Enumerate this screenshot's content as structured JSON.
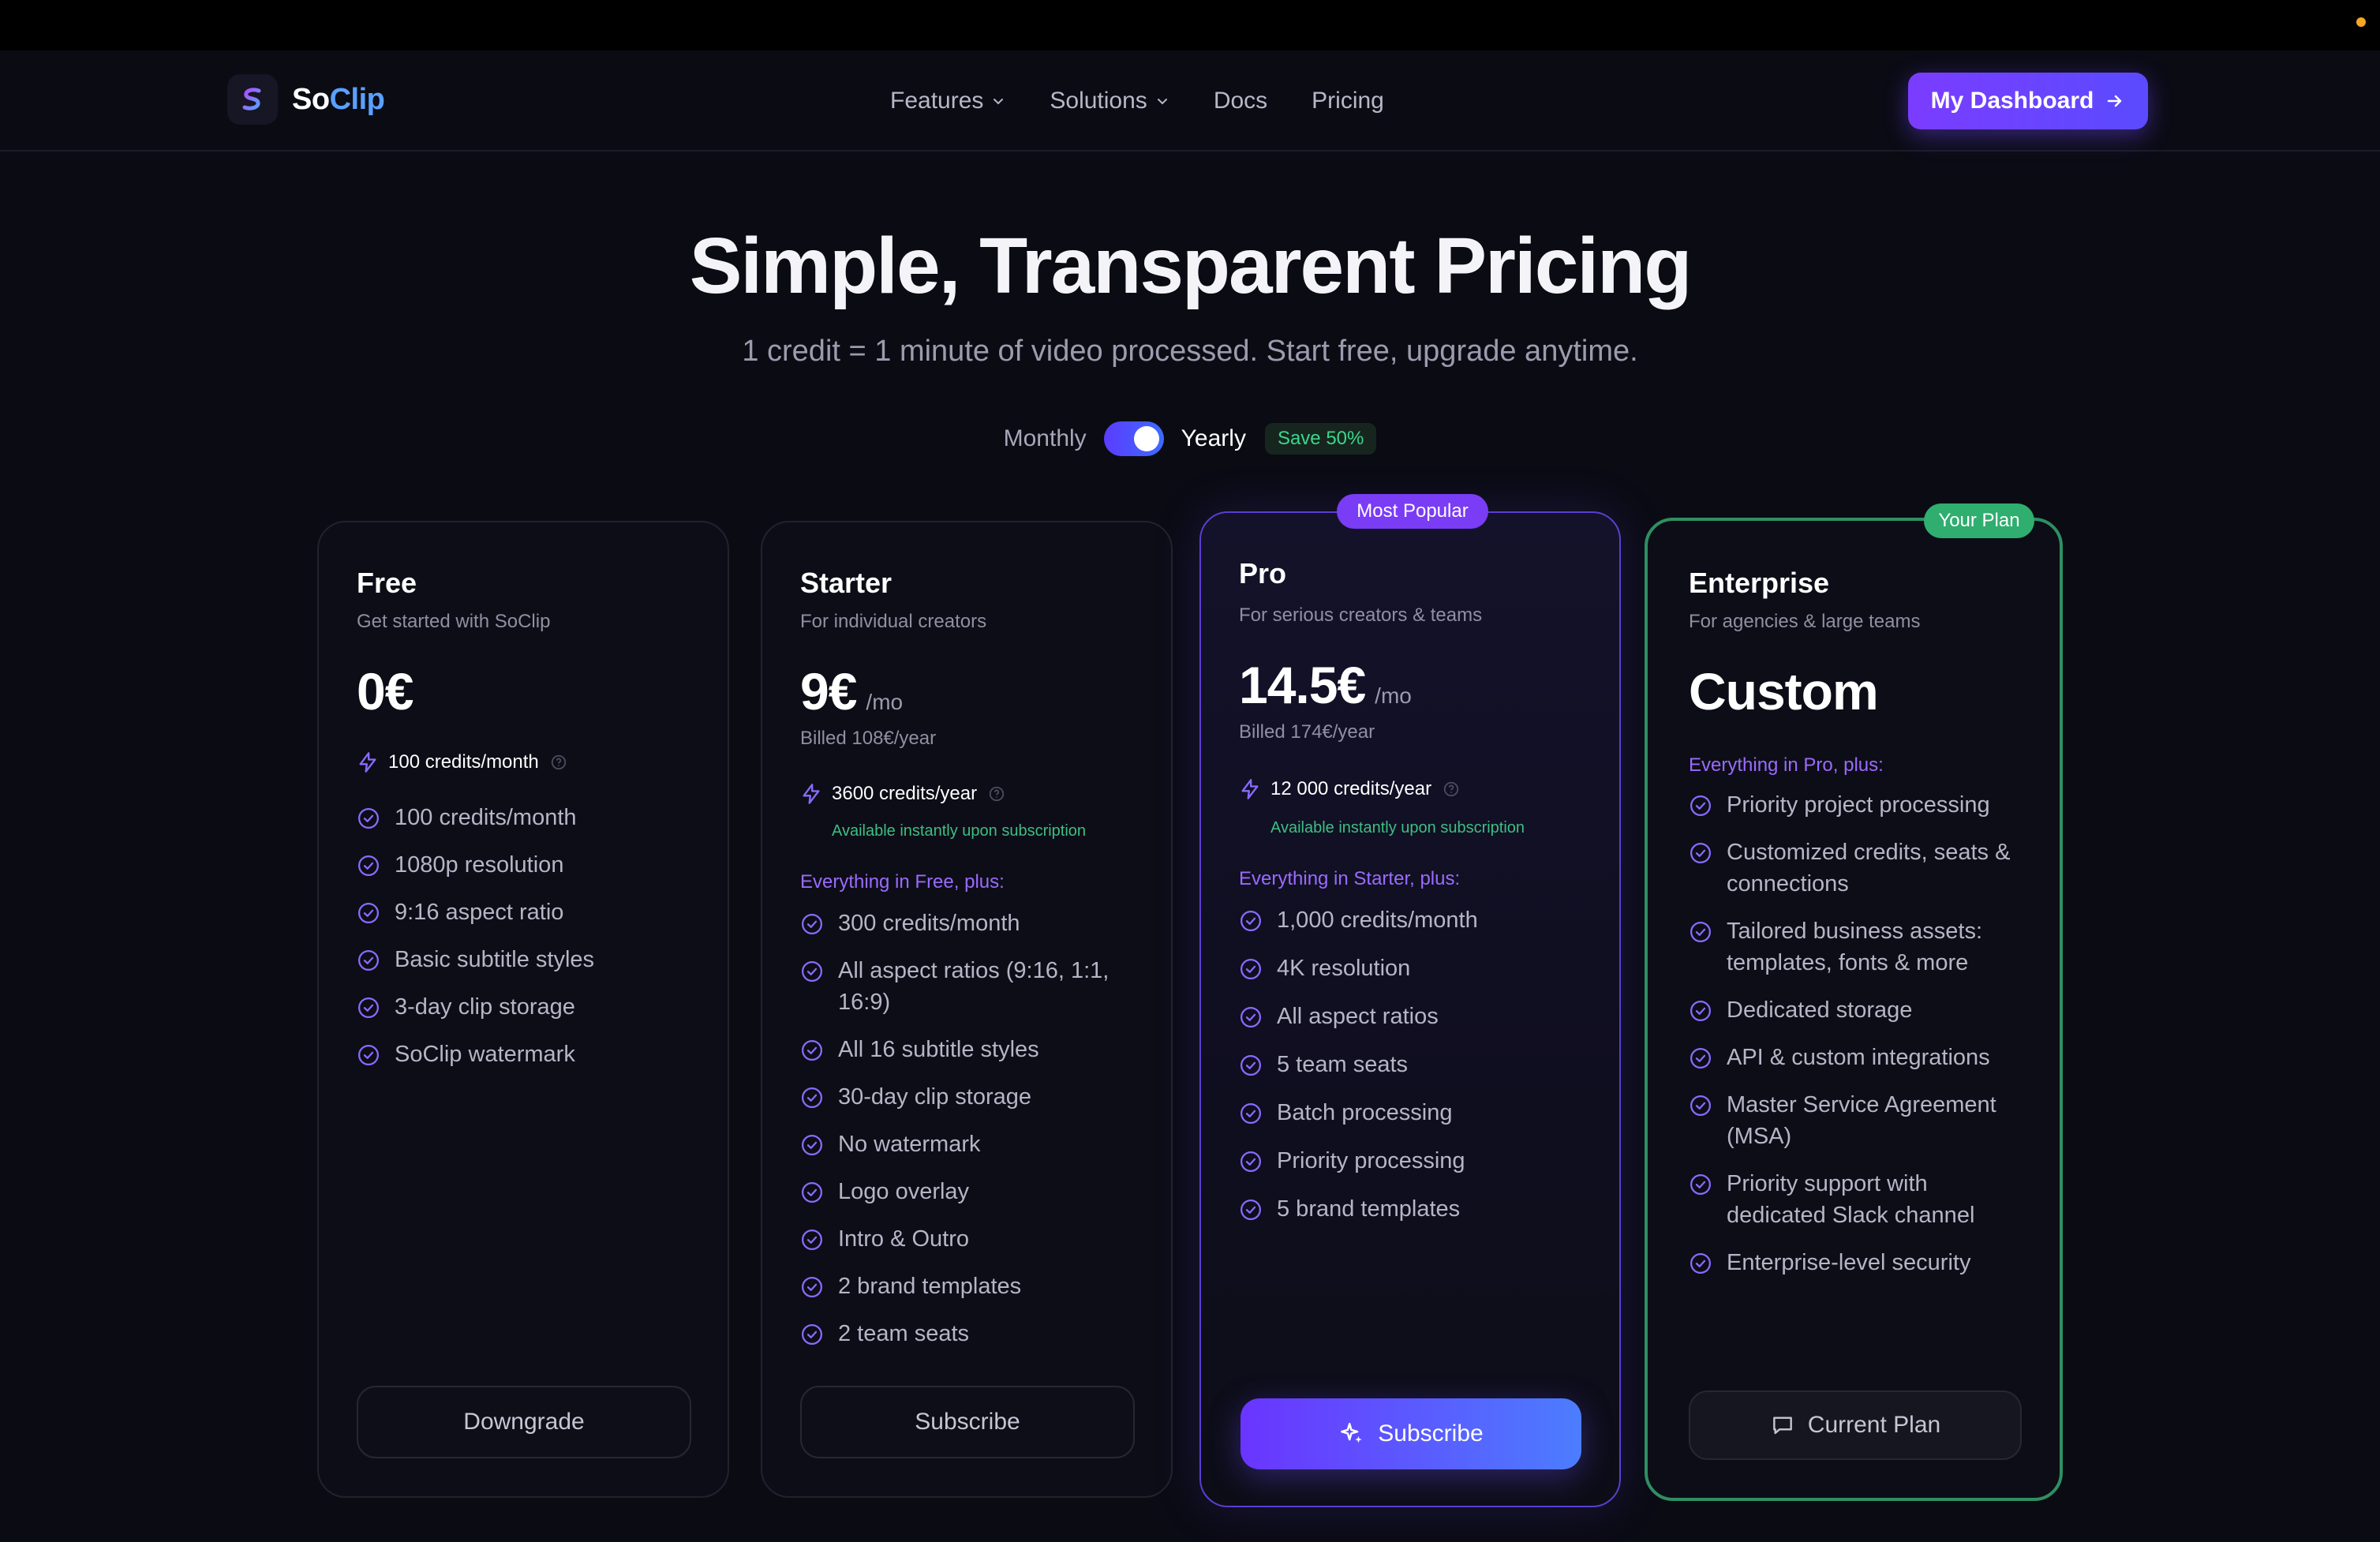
{
  "brand": {
    "name_part1": "So",
    "name_part2": "Clip",
    "accent": "#7b3cff",
    "secondary": "#5aa0ff",
    "success": "#3dd68c"
  },
  "nav": {
    "items": [
      {
        "label": "Features",
        "has_dropdown": true
      },
      {
        "label": "Solutions",
        "has_dropdown": true
      },
      {
        "label": "Docs",
        "has_dropdown": false
      },
      {
        "label": "Pricing",
        "has_dropdown": false
      }
    ],
    "dashboard_label": "My Dashboard"
  },
  "hero": {
    "title": "Simple, Transparent Pricing",
    "subtitle": "1 credit = 1 minute of video processed. Start free, upgrade anytime."
  },
  "billing": {
    "monthly_label": "Monthly",
    "yearly_label": "Yearly",
    "selected": "Yearly",
    "save_badge": "Save 50%"
  },
  "plans": [
    {
      "name": "Free",
      "description": "Get started with SoClip",
      "price": "0€",
      "credits": "100 credits/month",
      "features": [
        "100 credits/month",
        "1080p resolution",
        "9:16 aspect ratio",
        "Basic subtitle styles",
        "3-day clip storage",
        "SoClip watermark"
      ],
      "button": "Downgrade"
    },
    {
      "name": "Starter",
      "description": "For individual creators",
      "price": "9€",
      "period": "/mo",
      "billed": "Billed 108€/year",
      "credits": "3600 credits/year",
      "instant": "Available instantly upon subscription",
      "plus_heading": "Everything in Free, plus:",
      "features": [
        "300 credits/month",
        "All aspect ratios (9:16, 1:1, 16:9)",
        "All 16 subtitle styles",
        "30-day clip storage",
        "No watermark",
        "Logo overlay",
        "Intro & Outro",
        "2 brand templates",
        "2 team seats"
      ],
      "button": "Subscribe"
    },
    {
      "name": "Pro",
      "badge": "Most Popular",
      "description": "For serious creators & teams",
      "price": "14.5€",
      "period": "/mo",
      "billed": "Billed 174€/year",
      "credits": "12 000 credits/year",
      "instant": "Available instantly upon subscription",
      "plus_heading": "Everything in Starter, plus:",
      "features": [
        "1,000 credits/month",
        "4K resolution",
        "All aspect ratios",
        "5 team seats",
        "Batch processing",
        "Priority processing",
        "5 brand templates"
      ],
      "button": "Subscribe"
    },
    {
      "name": "Enterprise",
      "badge": "Your Plan",
      "description": "For agencies & large teams",
      "price": "Custom",
      "plus_heading": "Everything in Pro, plus:",
      "features": [
        "Priority project processing",
        "Customized credits, seats & connections",
        "Tailored business assets: templates, fonts & more",
        "Dedicated storage",
        "API & custom integrations",
        "Master Service Agreement (MSA)",
        "Priority support with dedicated Slack channel",
        "Enterprise-level security"
      ],
      "button": "Current Plan"
    }
  ]
}
